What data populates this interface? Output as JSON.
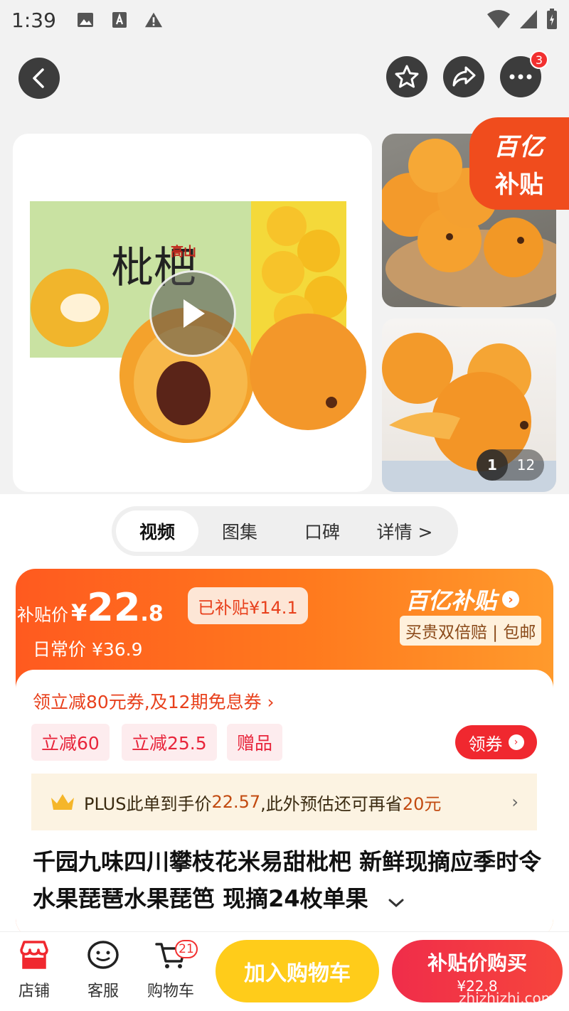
{
  "status_bar": {
    "time": "1:39"
  },
  "nav": {
    "more_badge": "3"
  },
  "gallery": {
    "subsidy_tag_line1": "百亿",
    "subsidy_tag_line2": "补贴",
    "box_text": "枇杷",
    "box_brand": "高山",
    "page_current": "1",
    "page_total": "12"
  },
  "tabs": [
    {
      "label": "视频"
    },
    {
      "label": "图集"
    },
    {
      "label": "口碑"
    },
    {
      "label": "详情 >"
    }
  ],
  "price": {
    "label": "补贴价",
    "currency": "¥",
    "integer": "22",
    "decimal": ".8",
    "subsidy_amount": "已补贴¥14.1",
    "daily_price": "日常价 ¥36.9",
    "brand_title": "百亿补贴",
    "brand_arrow": "›",
    "brand_sub": "买贵双倍赔 | 包邮"
  },
  "coupon": {
    "line": "领立减80元券,及12期免息券 ›",
    "chips": [
      "立减60",
      "立减25.5",
      "赠品"
    ],
    "get_button": "领券"
  },
  "plus_bar": {
    "prefix": "PLUS此单到手价",
    "price": "22.57",
    "middle": ",此外预估还可再省",
    "save": "20元",
    "chevron": "›"
  },
  "product": {
    "title": "千园九味四川攀枝花米易甜枇杷 新鲜现摘应季时令水果琵琶水果琵笆 现摘24枚单果"
  },
  "bottom_bar": {
    "shop": "店铺",
    "service": "客服",
    "cart": "购物车",
    "cart_count": "21",
    "add_to_cart": "加入购物车",
    "buy_line1": "补贴价购买",
    "buy_line2": "¥22.8",
    "watermark": "zhizhizhi.com"
  },
  "colors": {
    "brand_orange": "#ff5a1f",
    "red": "#f0282f",
    "yellow": "#ffcc1a"
  }
}
